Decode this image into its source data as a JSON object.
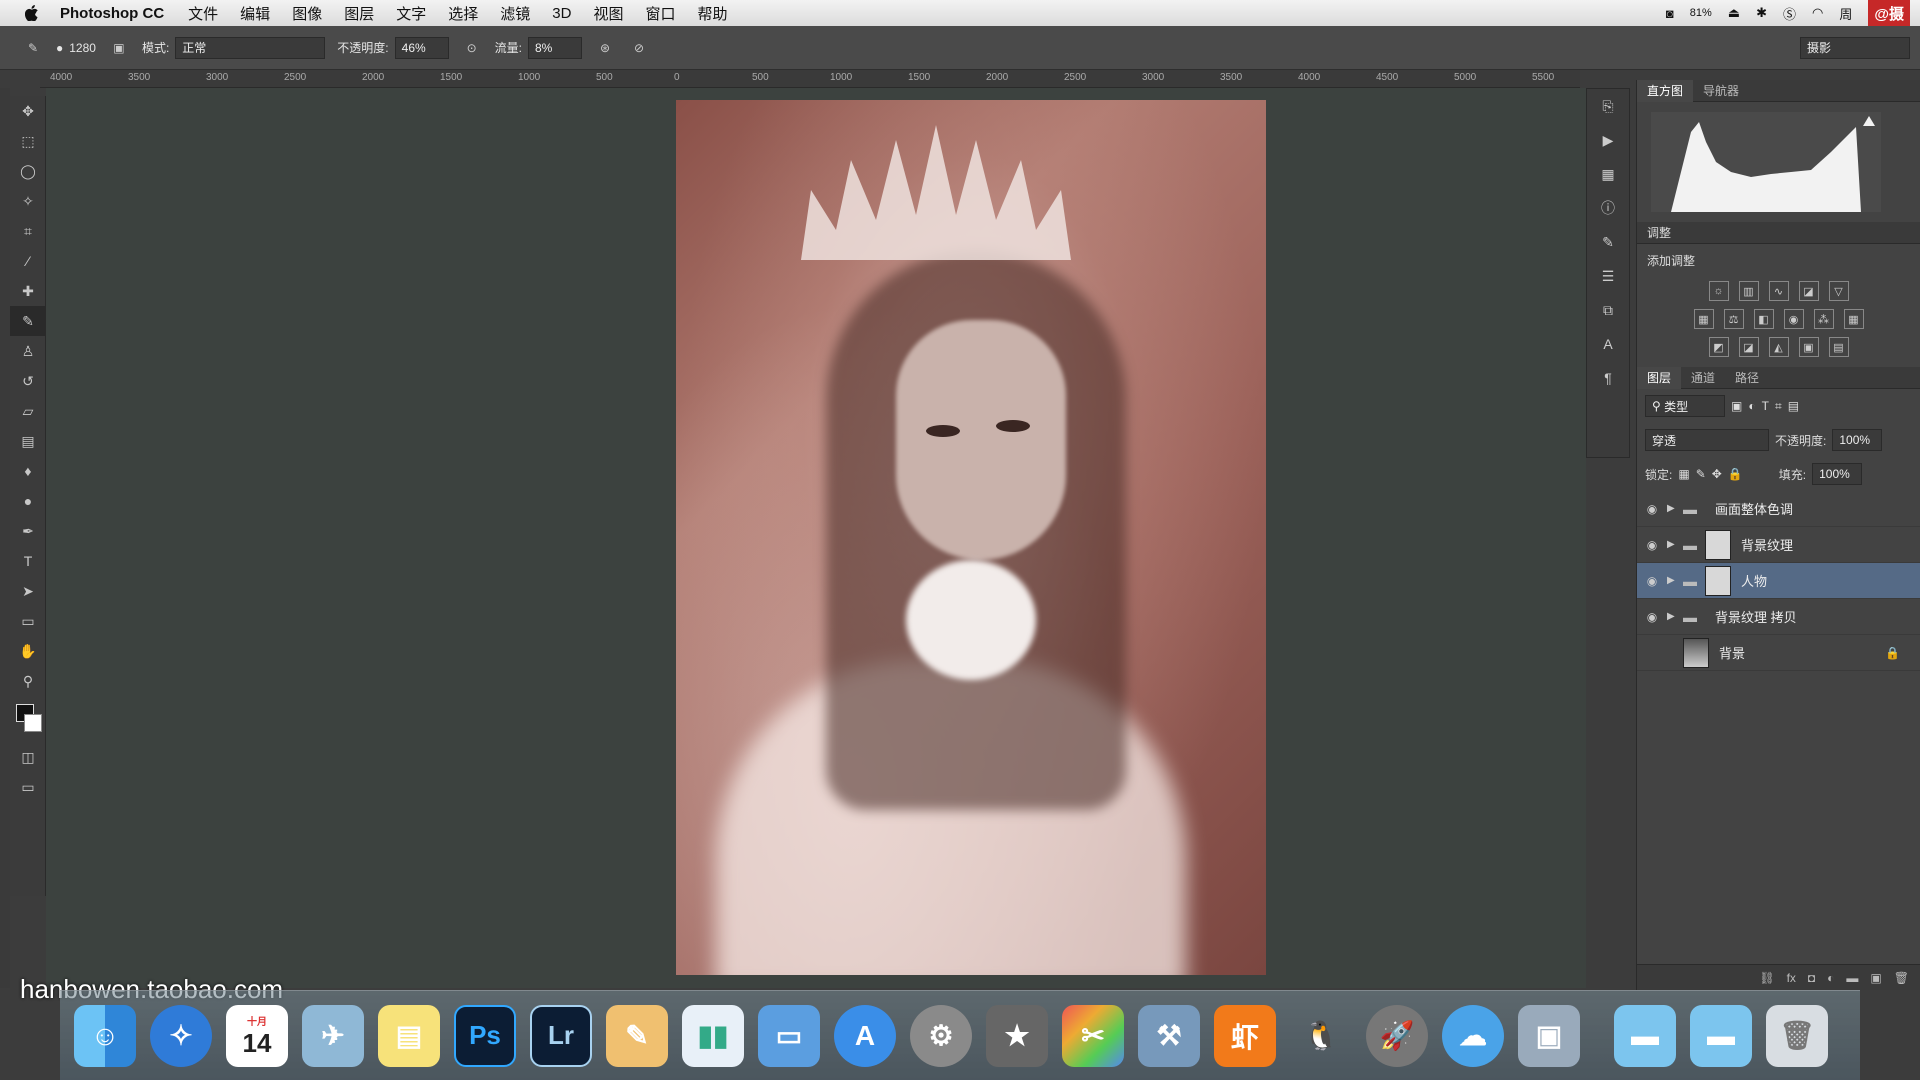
{
  "menubar": {
    "app_name": "Photoshop CC",
    "menus": [
      "文件",
      "编辑",
      "图像",
      "图层",
      "文字",
      "选择",
      "滤镜",
      "3D",
      "视图",
      "窗口",
      "帮助"
    ],
    "battery": "81%",
    "day": "周",
    "badge": "@摄"
  },
  "options": {
    "brush_size": "1280",
    "mode_label": "模式:",
    "mode_value": "正常",
    "opacity_label": "不透明度:",
    "opacity_value": "46%",
    "flow_label": "流量:",
    "flow_value": "8%",
    "workspace_value": "摄影"
  },
  "ruler": {
    "ticks": [
      "4000",
      "3500",
      "3000",
      "2500",
      "2000",
      "1500",
      "1000",
      "500",
      "0",
      "500",
      "1000",
      "1500",
      "2000",
      "2500",
      "3000",
      "3500",
      "4000",
      "4500",
      "5000",
      "5500"
    ]
  },
  "panels": {
    "histogram_tabs": [
      "直方图",
      "导航器"
    ],
    "adjust_title": "调整",
    "adjust_add": "添加调整",
    "layers_tabs": [
      "图层",
      "通道",
      "路径"
    ],
    "filter_kind": "类型",
    "blend_mode": "穿透",
    "opacity_label": "不透明度:",
    "opacity_value": "100%",
    "lock_label": "锁定:",
    "fill_label": "填充:",
    "fill_value": "100%",
    "layers": [
      {
        "name": "画面整体色调"
      },
      {
        "name": "背景纹理"
      },
      {
        "name": "人物"
      },
      {
        "name": "背景纹理 拷贝"
      },
      {
        "name": "背景"
      }
    ]
  },
  "dock": {
    "calendar_day": "14",
    "calendar_month": "十月",
    "ps_label": "Ps",
    "lr_label": "Lr",
    "xia_label": "虾"
  },
  "watermark": "hanbowen.taobao.com",
  "colors": {
    "selected_layer": "#556a86",
    "canvas_bg": "#3c423f",
    "ps_blue": "#31a8ff"
  }
}
